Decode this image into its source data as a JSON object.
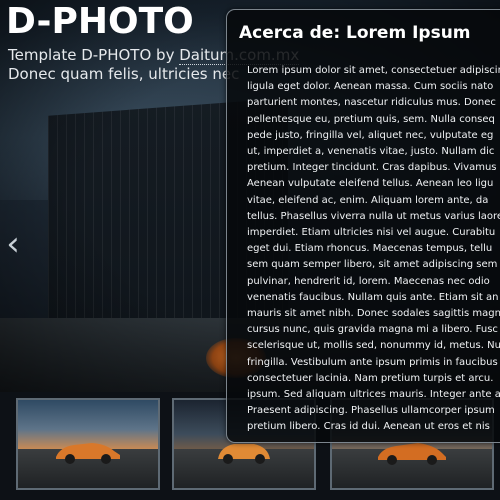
{
  "header": {
    "title": "D-PHOTO",
    "tagline_prefix": "Template D-PHOTO by ",
    "tagline_credit": "Daitum.com.mx",
    "tagline_line2": "Donec quam felis, ultricies nec"
  },
  "slider": {
    "prev_arrow": "‹"
  },
  "info": {
    "title": "Acerca de: Lorem Ipsum",
    "body_lines": [
      "Lorem ipsum dolor sit amet, consectetuer adipiscing",
      "ligula eget dolor. Aenean massa. Cum sociis nato",
      "parturient montes, nascetur ridiculus mus. Donec",
      "pellentesque eu, pretium quis, sem. Nulla conseq",
      "pede justo, fringilla vel, aliquet nec, vulputate eg",
      "ut, imperdiet a, venenatis vitae, justo. Nullam dic",
      "pretium. Integer tincidunt. Cras dapibus. Vivamus",
      "Aenean vulputate eleifend tellus. Aenean leo ligu",
      "vitae, eleifend ac, enim. Aliquam lorem ante, da",
      "tellus. Phasellus viverra nulla ut metus varius laore",
      "imperdiet. Etiam ultricies nisi vel augue. Curabitu",
      "eget dui. Etiam rhoncus. Maecenas tempus, tellu",
      "sem quam semper libero, sit amet adipiscing sem",
      "pulvinar, hendrerit id, lorem. Maecenas nec odio",
      "venenatis faucibus. Nullam quis ante. Etiam sit an",
      "mauris sit amet nibh. Donec sodales sagittis magn",
      "cursus nunc, quis gravida magna mi a libero. Fusc",
      "scelerisque ut, mollis sed, nonummy id, metus. Nu",
      "fringilla. Vestibulum ante ipsum primis in faucibus",
      "consectetuer lacinia. Nam pretium turpis et arcu.",
      "ipsum. Sed aliquam ultrices mauris. Integer ante a",
      "Praesent adipiscing. Phasellus ullamcorper ipsum",
      "pretium libero. Cras id dui. Aenean ut eros et nis"
    ]
  },
  "thumbnails": [
    {
      "car_color": "#d9782a"
    },
    {
      "car_color": "#e08a35"
    },
    {
      "car_color": "#d36d22"
    }
  ],
  "colors": {
    "panel_border": "#7c858d",
    "thumb_border": "#5e6a74",
    "accent_car": "#d9782a"
  }
}
